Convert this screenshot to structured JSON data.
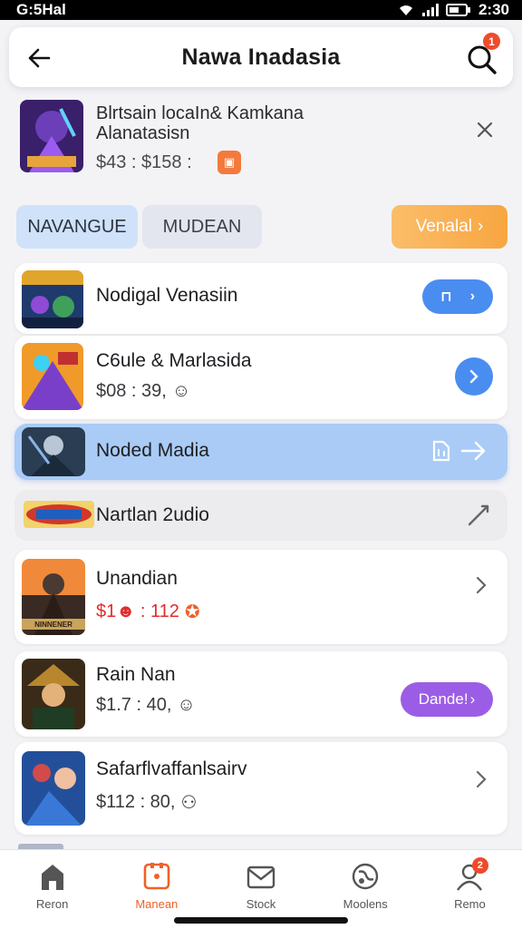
{
  "status_bar": {
    "left": "G:5Hal",
    "time": "2:30"
  },
  "header": {
    "title": "Nawa Inadasia",
    "search_badge": "1"
  },
  "top_item": {
    "name_line1": "Blrtsain locaIn& Kamkana",
    "name_line2": "Alanatasisn",
    "price": "$43 : $158 :",
    "badge_glyph": "▣"
  },
  "filters": {
    "chip1": "NAVANGUE",
    "chip2": "MUDEAN",
    "view_all": "Venalal",
    "view_all_arrow": "›"
  },
  "rows": [
    {
      "name": "Nodigal Venasiin",
      "pill_left": "⊓",
      "pill_right": "›"
    },
    {
      "name": "C6ule & Marlasida",
      "price": "$08 : 39,",
      "price_icon": "☺"
    },
    {
      "name": "Noded Madia"
    },
    {
      "name": "Nartlan 2udio"
    },
    {
      "name": "Unandian",
      "price": "$1☻ : 112",
      "price_icon": "✪",
      "thumb_caption": "NINNENER"
    },
    {
      "name": "Rain Nan",
      "price": "$1.7 : 40,",
      "price_icon": "☺",
      "pill": "Dande!",
      "pill_arrow": "›"
    },
    {
      "name": "Safarflvaffanlsairv",
      "price": "$112 : 80,",
      "price_icon": "⚇"
    }
  ],
  "tabs": [
    {
      "label": "Reron",
      "icon": "home-icon"
    },
    {
      "label": "Manean",
      "icon": "tag-icon",
      "active": true
    },
    {
      "label": "Stock",
      "icon": "mail-icon"
    },
    {
      "label": "Moolens",
      "icon": "globe-icon"
    },
    {
      "label": "Remo",
      "icon": "profile-icon",
      "badge": "2"
    }
  ],
  "colors": {
    "accent_blue": "#4a8df0",
    "accent_orange": "#f8a640",
    "accent_purple": "#9b5de5",
    "active_tab": "#f0612a"
  }
}
